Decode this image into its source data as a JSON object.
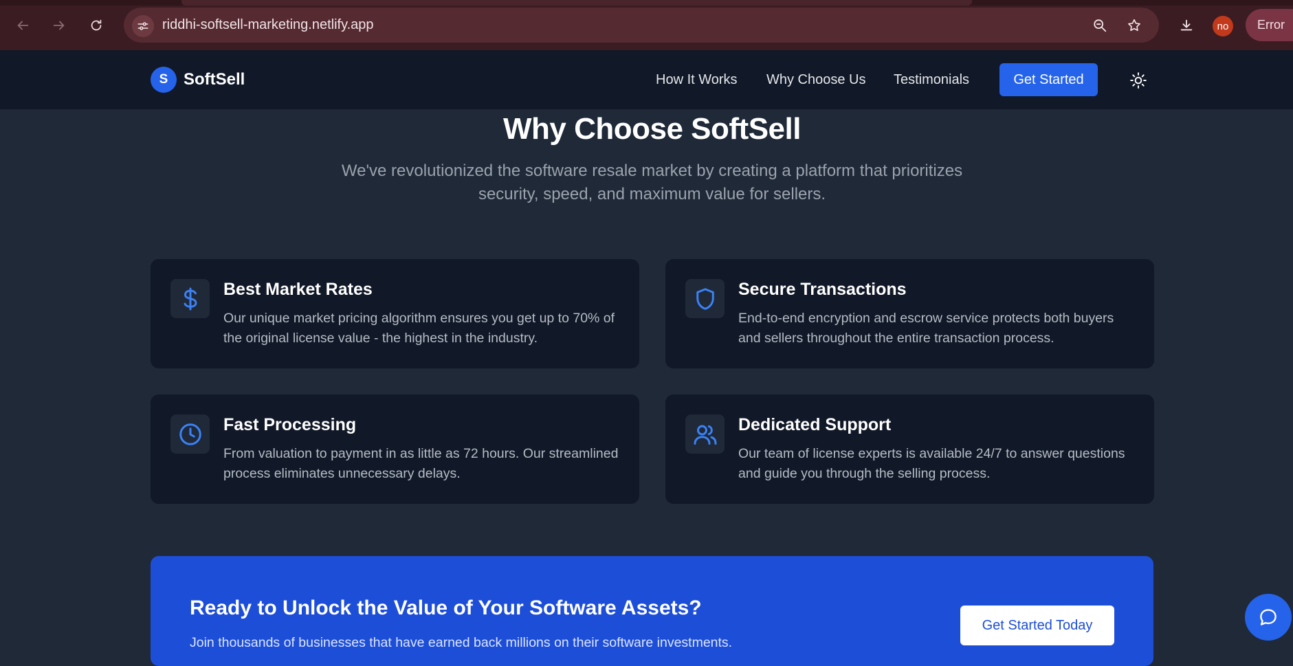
{
  "browser": {
    "url": "riddhi-softsell-marketing.netlify.app",
    "profile_initials": "no",
    "status_pill": "Error"
  },
  "colors": {
    "page_bg": "#1f2937",
    "header_bg": "#111827",
    "card_bg": "#111827",
    "accent": "#2563eb",
    "cta_band": "#1d4ed8",
    "icon_accent": "#3b82f6"
  },
  "header": {
    "logo_letter": "S",
    "brand": "SoftSell",
    "nav": [
      "How It Works",
      "Why Choose Us",
      "Testimonials"
    ],
    "cta_label": "Get Started",
    "theme_icon": "sun-icon"
  },
  "why": {
    "title": "Why Choose SoftSell",
    "subtitle": "We've revolutionized the software resale market by creating a platform that prioritizes security, speed, and maximum value for sellers.",
    "cards": [
      {
        "icon": "dollar-icon",
        "title": "Best Market Rates",
        "description": "Our unique market pricing algorithm ensures you get up to 70% of the original license value - the highest in the industry."
      },
      {
        "icon": "shield-icon",
        "title": "Secure Transactions",
        "description": "End-to-end encryption and escrow service protects both buyers and sellers throughout the entire transaction process."
      },
      {
        "icon": "clock-icon",
        "title": "Fast Processing",
        "description": "From valuation to payment in as little as 72 hours. Our streamlined process eliminates unnecessary delays."
      },
      {
        "icon": "users-icon",
        "title": "Dedicated Support",
        "description": "Our team of license experts is available 24/7 to answer questions and guide you through the selling process."
      }
    ]
  },
  "cta": {
    "title": "Ready to Unlock the Value of Your Software Assets?",
    "text": "Join thousands of businesses that have earned back millions on their software investments.",
    "button": "Get Started Today"
  },
  "chat": {
    "icon": "chat-bubble-icon"
  }
}
